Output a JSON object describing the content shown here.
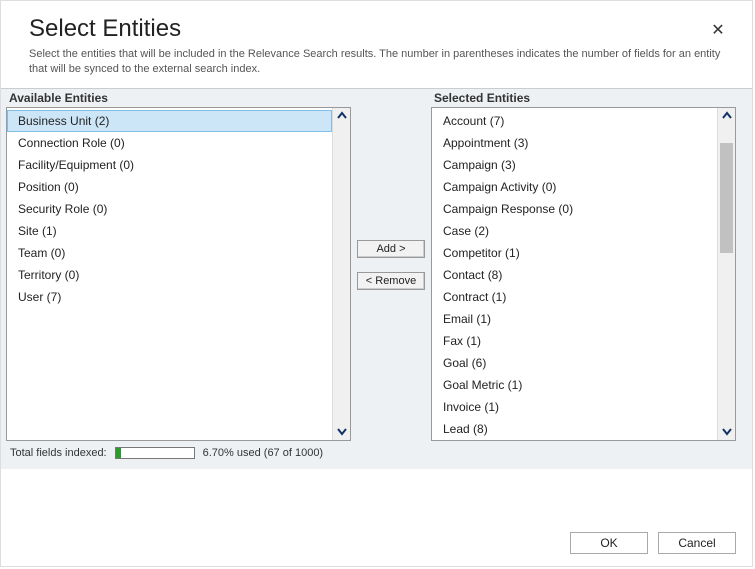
{
  "header": {
    "title": "Select Entities",
    "subtitle": "Select the entities that will be included in the Relevance Search results. The number in parentheses indicates the number of fields for an entity that will be synced to the external search index."
  },
  "available": {
    "header": "Available Entities",
    "items": [
      {
        "label": "Business Unit (2)",
        "selected": true
      },
      {
        "label": "Connection Role (0)"
      },
      {
        "label": "Facility/Equipment (0)"
      },
      {
        "label": "Position (0)"
      },
      {
        "label": "Security Role (0)"
      },
      {
        "label": "Site (1)"
      },
      {
        "label": "Team (0)"
      },
      {
        "label": "Territory (0)"
      },
      {
        "label": "User (7)"
      }
    ]
  },
  "selected": {
    "header": "Selected Entities",
    "items": [
      {
        "label": "Account (7)"
      },
      {
        "label": "Appointment (3)"
      },
      {
        "label": "Campaign (3)"
      },
      {
        "label": "Campaign Activity (0)"
      },
      {
        "label": "Campaign Response (0)"
      },
      {
        "label": "Case (2)"
      },
      {
        "label": "Competitor (1)"
      },
      {
        "label": "Contact (8)"
      },
      {
        "label": "Contract (1)"
      },
      {
        "label": "Email (1)"
      },
      {
        "label": "Fax (1)"
      },
      {
        "label": "Goal (6)"
      },
      {
        "label": "Goal Metric (1)"
      },
      {
        "label": "Invoice (1)"
      },
      {
        "label": "Lead (8)"
      }
    ]
  },
  "buttons": {
    "add": "Add >",
    "remove": "< Remove",
    "ok": "OK",
    "cancel": "Cancel"
  },
  "status": {
    "label": "Total fields indexed:",
    "percent_text": "6.70% used (67 of 1000)",
    "progress_percent": 6.7
  }
}
